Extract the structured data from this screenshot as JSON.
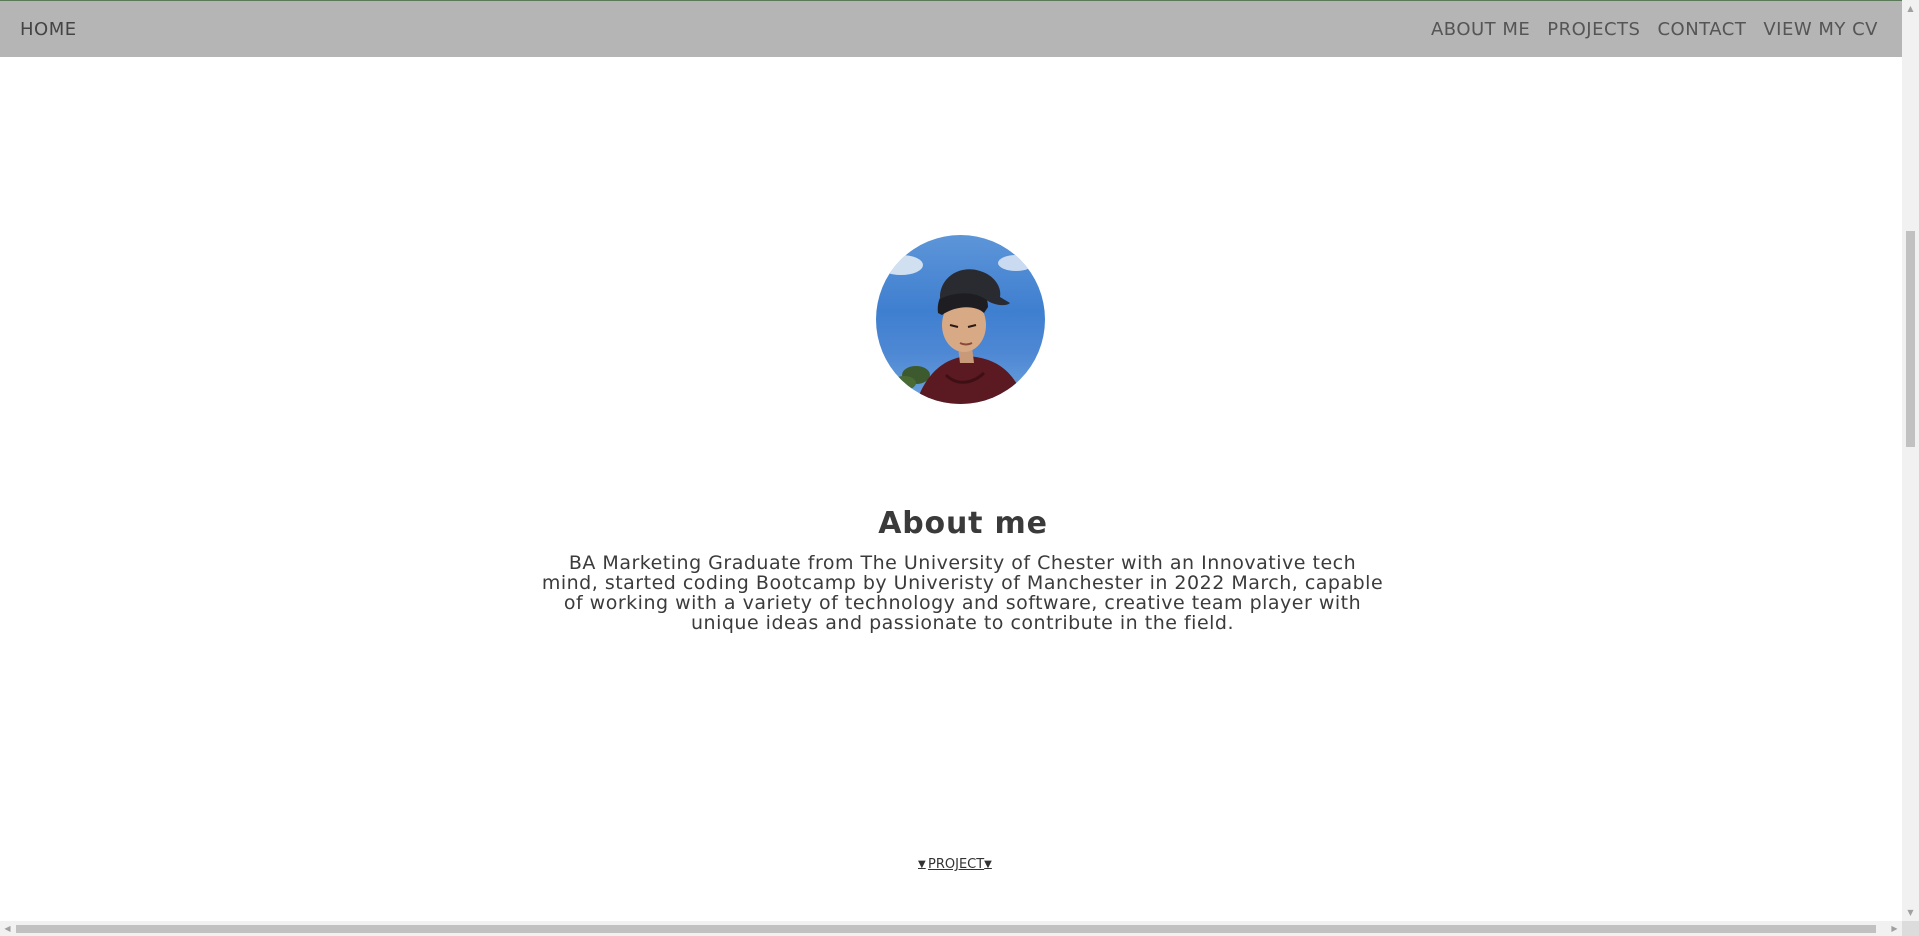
{
  "nav": {
    "home": "HOME",
    "links": [
      "ABOUT ME",
      "PROJECTS",
      "CONTACT",
      "VIEW MY CV"
    ]
  },
  "about": {
    "title": "About me",
    "text": "BA Marketing Graduate from The University of Chester with an Innovative tech mind, started coding Bootcamp by Univeristy of Manchester in 2022 March, capable of working with a variety of technology and software, creative team player with unique ideas and passionate to contribute in the field."
  },
  "project_link": {
    "label": "PROJECT",
    "icon_left": "chevron-down-icon",
    "icon_right": "chevron-down-icon"
  },
  "colors": {
    "navbar_bg": "#b5b5b5",
    "text": "#3b3b3b"
  }
}
